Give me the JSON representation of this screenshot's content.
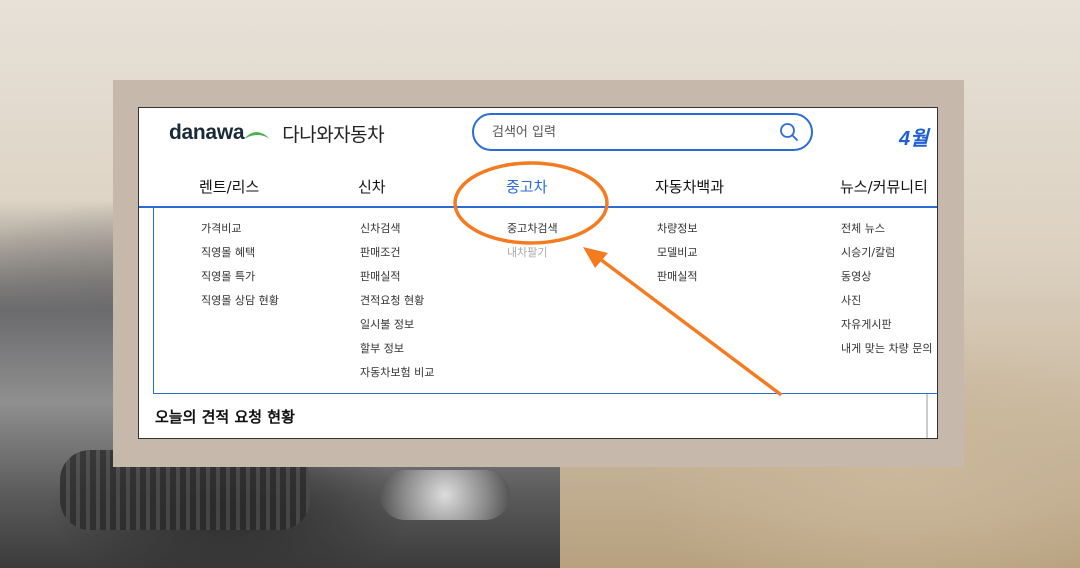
{
  "brand": {
    "logo_text": "danawa",
    "site_name": "다나와자동차"
  },
  "search": {
    "placeholder": "검색어 입력"
  },
  "promo": {
    "text": "4월"
  },
  "nav": {
    "items": [
      {
        "label": "렌트/리스"
      },
      {
        "label": "신차"
      },
      {
        "label": "중고차"
      },
      {
        "label": "자동차백과"
      },
      {
        "label": "뉴스/커뮤니티"
      }
    ],
    "active_index": 2
  },
  "dropdown": {
    "columns": [
      {
        "items": [
          "가격비교",
          "직영몰 혜택",
          "직영몰 특가",
          "직영몰 상담 현황"
        ]
      },
      {
        "items": [
          "신차검색",
          "판매조건",
          "판매실적",
          "견적요청 현황",
          "일시불 정보",
          "할부 정보",
          "자동차보험 비교"
        ]
      },
      {
        "items": [
          "중고차검색",
          "내차팔기"
        ]
      },
      {
        "items": [
          "차량정보",
          "모델비교",
          "판매실적"
        ]
      },
      {
        "items": [
          "전체 뉴스",
          "시승기/칼럼",
          "동영상",
          "사진",
          "자유게시판",
          "내게 맞는 차량 문의"
        ]
      }
    ]
  },
  "section": {
    "today_title": "오늘의 견적 요청 현황"
  },
  "colors": {
    "accent": "#2b6bd6",
    "annotation": "#f47b20",
    "logo_green": "#4caf50",
    "overlay": "#c6b9ab"
  }
}
